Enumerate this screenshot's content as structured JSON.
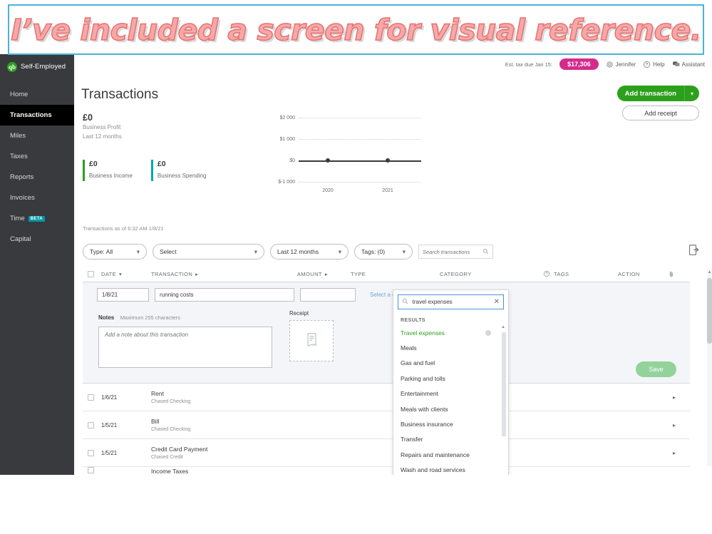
{
  "banner": {
    "text": "I’ve included a screen for visual reference."
  },
  "sidebar": {
    "brand": "Self-Employed",
    "logo_glyph": "qb",
    "items": [
      {
        "label": "Home",
        "icon": "home-icon"
      },
      {
        "label": "Transactions",
        "icon": "transactions-icon"
      },
      {
        "label": "Miles",
        "icon": "miles-icon"
      },
      {
        "label": "Taxes",
        "icon": "taxes-icon"
      },
      {
        "label": "Reports",
        "icon": "reports-icon"
      },
      {
        "label": "Invoices",
        "icon": "invoices-icon"
      },
      {
        "label": "Time",
        "icon": "time-icon",
        "badge": "BETA"
      },
      {
        "label": "Capital",
        "icon": "capital-icon"
      }
    ],
    "active": "Transactions"
  },
  "topbar": {
    "tax_label": "Est. tax due Jan 15:",
    "tax_amount": "$17,306",
    "tax_pill_color": "#d52b8c",
    "user": "Jennifer",
    "help": "Help",
    "assistant": "Assistant"
  },
  "header": {
    "title": "Transactions",
    "add_transaction": "Add transaction",
    "add_receipt": "Add receipt",
    "accent_green": "#2ca01c"
  },
  "summary": {
    "profit_value": "£0",
    "profit_label": "Business Profit",
    "profit_period": "Last 12 months",
    "income_value": "£0",
    "income_label": "Business Income",
    "income_color": "#2ca01c",
    "spending_value": "£0",
    "spending_label": "Business Spending",
    "spending_color": "#00a6b6"
  },
  "chart_data": {
    "type": "line",
    "title": "Business Profit Last 12 months",
    "x": [
      "2020",
      "2021"
    ],
    "series": [
      {
        "name": "Business Profit",
        "values": [
          0,
          0
        ]
      }
    ],
    "ytick_labels": [
      "$2 000",
      "$1 000",
      "$0",
      "$-1 000"
    ],
    "ytick_values": [
      2000,
      1000,
      0,
      -1000
    ],
    "ylim": [
      -1000,
      2000
    ],
    "xlabel": "",
    "ylabel": "",
    "grid": true,
    "legend": "none"
  },
  "asof": "Transactions as of 6:32 AM 1/8/21",
  "filters": {
    "type": "Type: All",
    "select": "Select",
    "period": "Last 12 months",
    "tags": "Tags: (0)",
    "search_placeholder": "Search transactions",
    "search_value": "",
    "export_icon": "export-icon"
  },
  "table": {
    "headers": {
      "date": "DATE",
      "transaction": "TRANSACTION",
      "amount": "AMOUNT",
      "type": "TYPE",
      "category": "CATEGORY",
      "tags": "TAGS",
      "action": "ACTION"
    },
    "sort_glyph_date": "▾",
    "sort_glyph_txn": "▸",
    "sort_glyph_amt": "▸",
    "edit_row": {
      "date": "1/8/21",
      "transaction": "running costs",
      "amount": "",
      "category_placeholder": "Select a category",
      "notes_label": "Notes",
      "notes_hint": "Maximum 255 characters",
      "notes_placeholder": "Add a note about this transaction",
      "receipt_label": "Receipt",
      "save_label": "Save"
    },
    "rows": [
      {
        "date": "1/6/21",
        "name": "Rent",
        "account": "Chased Checking",
        "caret": "▸"
      },
      {
        "date": "1/5/21",
        "name": "Bill",
        "account": "Chased Checking",
        "caret": "▸"
      },
      {
        "date": "1/5/21",
        "name": "Credit Card Payment",
        "account": "Chased Credit",
        "caret": "▸"
      },
      {
        "date": "",
        "name": "Income Taxes",
        "account": "",
        "caret": ""
      }
    ]
  },
  "category_dropdown": {
    "search_value": "travel expenses",
    "clear_glyph": "✕",
    "results_label": "RESULTS",
    "items": [
      "Travel expenses",
      "Meals",
      "Gas and fuel",
      "Parking and tolls",
      "Entertainment",
      "Meals with clients",
      "Business insurance",
      "Transfer",
      "Repairs and maintenance",
      "Wash and road services"
    ],
    "selected": "Travel expenses",
    "selected_color": "#2ca01c"
  }
}
